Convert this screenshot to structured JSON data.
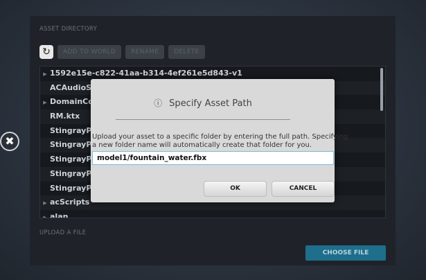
{
  "close": {
    "glyph": "✖"
  },
  "directory": {
    "label": "ASSET DIRECTORY",
    "refresh_glyph": "↻",
    "toolbar": {
      "add": "ADD TO WORLD",
      "rename": "RENAME",
      "delete": "DELETE"
    },
    "items": [
      {
        "label": "1592e15e-c822-41aa-b314-4ef261e5d843-v1",
        "folder": true
      },
      {
        "label": "ACAudioSe",
        "folder": false
      },
      {
        "label": "DomainCo",
        "folder": true
      },
      {
        "label": "RM.ktx",
        "folder": false
      },
      {
        "label": "StingrayPB",
        "folder": false
      },
      {
        "label": "StingrayPB",
        "folder": false
      },
      {
        "label": "StingrayPB",
        "folder": false
      },
      {
        "label": "StingrayPB",
        "folder": false
      },
      {
        "label": "StingrayPB",
        "folder": false
      },
      {
        "label": "acScripts",
        "folder": true
      },
      {
        "label": "alan",
        "folder": true
      }
    ]
  },
  "upload": {
    "label": "UPLOAD A FILE",
    "choose": "CHOOSE FILE"
  },
  "dialog": {
    "title": "Specify Asset Path",
    "info_glyph": "ⓘ",
    "message_line1": "Upload your asset to a specific folder by entering the full path. Specifying",
    "message_line2": "a new folder name will automatically create that folder for you.",
    "path_value": "model1/fountain_water.fbx",
    "ok": "OK",
    "cancel": "CANCEL"
  }
}
